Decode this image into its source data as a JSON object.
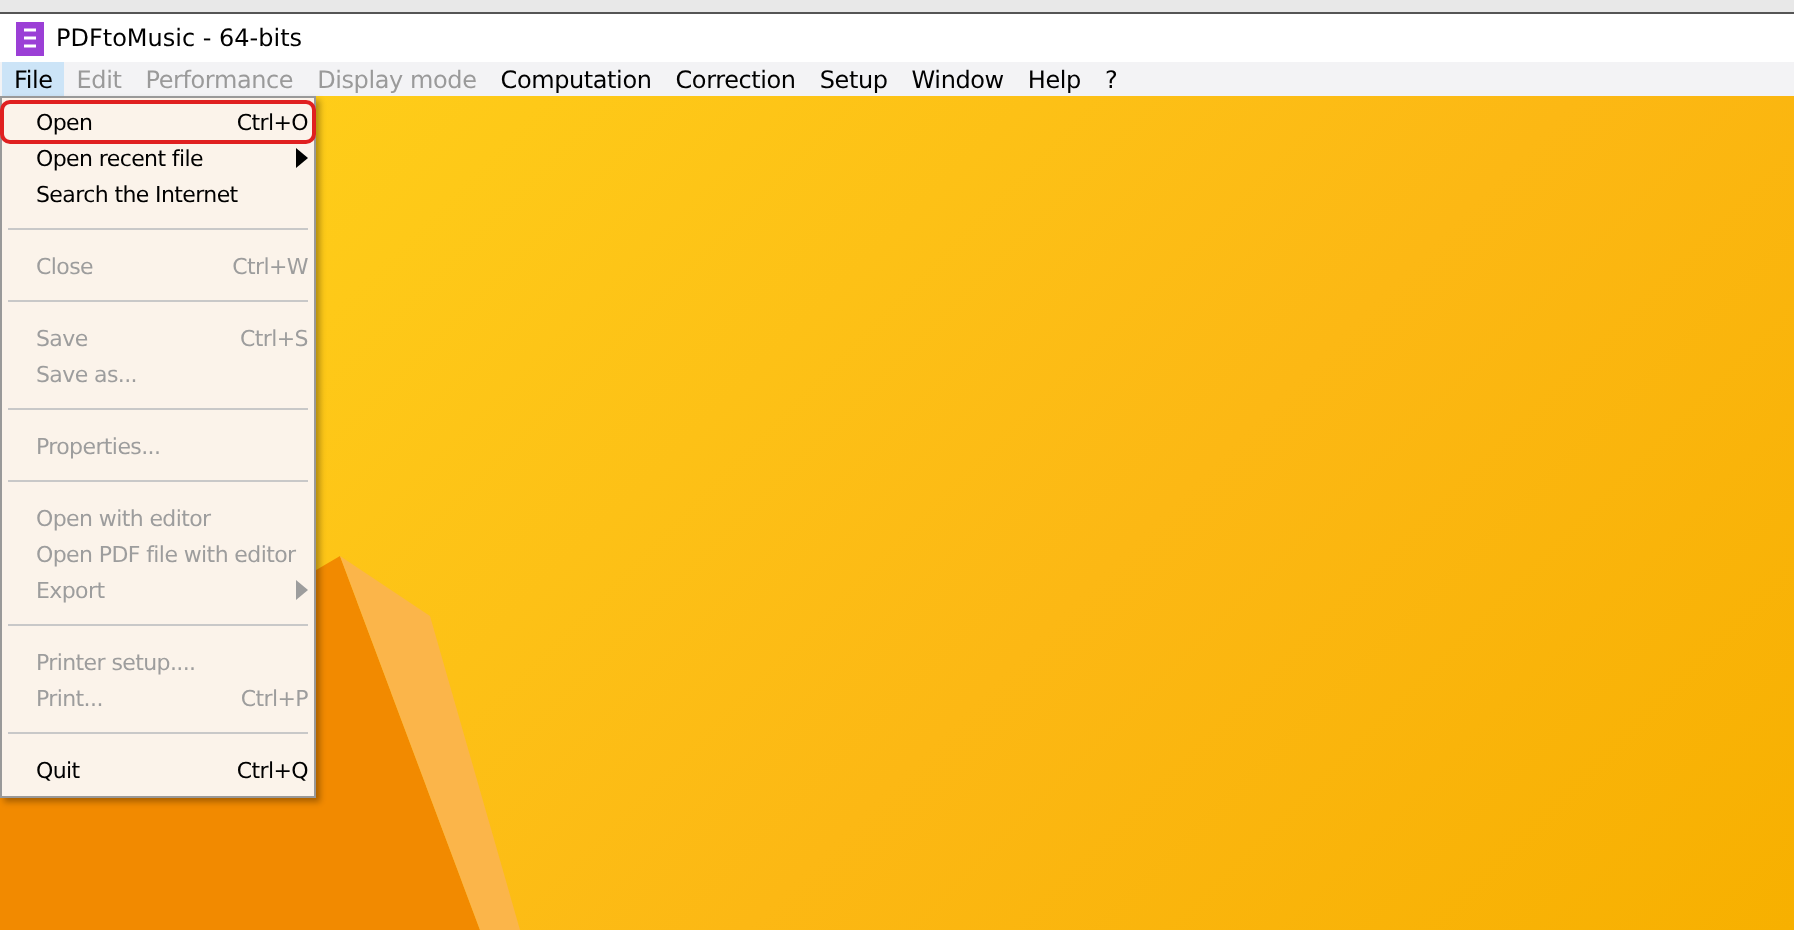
{
  "window": {
    "title": "PDFtoMusic - 64-bits"
  },
  "menubar": [
    {
      "label": "File",
      "selected": true,
      "disabled": false
    },
    {
      "label": "Edit",
      "selected": false,
      "disabled": true
    },
    {
      "label": "Performance",
      "selected": false,
      "disabled": true
    },
    {
      "label": "Display mode",
      "selected": false,
      "disabled": true
    },
    {
      "label": "Computation",
      "selected": false,
      "disabled": false
    },
    {
      "label": "Correction",
      "selected": false,
      "disabled": false
    },
    {
      "label": "Setup",
      "selected": false,
      "disabled": false
    },
    {
      "label": "Window",
      "selected": false,
      "disabled": false
    },
    {
      "label": "Help",
      "selected": false,
      "disabled": false
    },
    {
      "label": "?",
      "selected": false,
      "disabled": false
    }
  ],
  "file_menu": [
    {
      "kind": "item",
      "label": "Open",
      "shortcut": "Ctrl+O",
      "disabled": false,
      "highlighted": true
    },
    {
      "kind": "submenu",
      "label": "Open recent file",
      "disabled": false,
      "highlighted": false
    },
    {
      "kind": "item",
      "label": "Search the Internet",
      "disabled": false,
      "highlighted": false
    },
    {
      "kind": "separator"
    },
    {
      "kind": "item",
      "label": "Close",
      "shortcut": "Ctrl+W",
      "disabled": true,
      "highlighted": false
    },
    {
      "kind": "separator"
    },
    {
      "kind": "item",
      "label": "Save",
      "shortcut": "Ctrl+S",
      "disabled": true,
      "highlighted": false
    },
    {
      "kind": "item",
      "label": "Save as...",
      "disabled": true,
      "highlighted": false
    },
    {
      "kind": "separator"
    },
    {
      "kind": "item",
      "label": "Properties...",
      "disabled": true,
      "highlighted": false
    },
    {
      "kind": "separator"
    },
    {
      "kind": "item",
      "label": "Open with editor",
      "disabled": true,
      "highlighted": false
    },
    {
      "kind": "item",
      "label": "Open PDF file with editor",
      "disabled": true,
      "highlighted": false
    },
    {
      "kind": "submenu",
      "label": "Export",
      "disabled": true,
      "highlighted": false
    },
    {
      "kind": "separator"
    },
    {
      "kind": "item",
      "label": "Printer setup....",
      "disabled": true,
      "highlighted": false
    },
    {
      "kind": "item",
      "label": "Print...",
      "shortcut": "Ctrl+P",
      "disabled": true,
      "highlighted": false
    },
    {
      "kind": "separator"
    },
    {
      "kind": "item",
      "label": "Quit",
      "shortcut": "Ctrl+Q",
      "disabled": false,
      "highlighted": false
    }
  ]
}
